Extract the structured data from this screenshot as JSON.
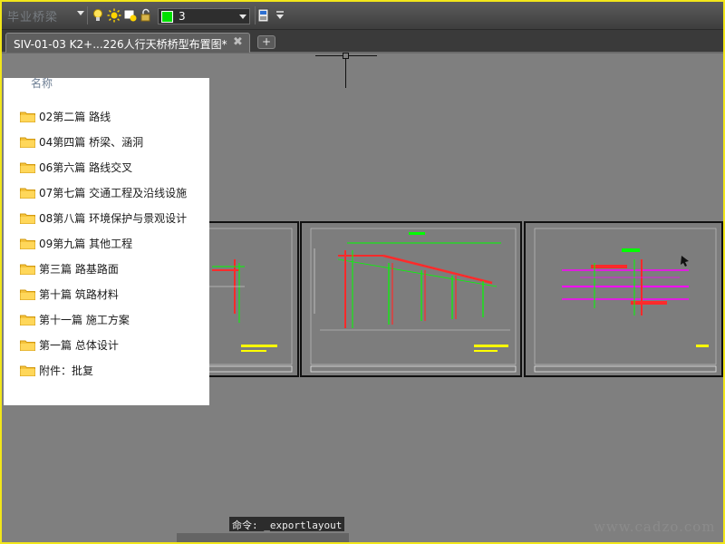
{
  "toolbar": {
    "ghost_text": "毕业桥梁",
    "layer": {
      "name": "3",
      "swatch_color": "#00e000"
    }
  },
  "tabs": [
    {
      "title": "SIV-01-03 K2+...226人行天桥桥型布置图*",
      "close": "✖"
    }
  ],
  "tab_add": "+",
  "folder_panel": {
    "header": "名称",
    "items": [
      "02第二篇 路线",
      "04第四篇 桥梁、涵洞",
      "06第六篇 路线交叉",
      "07第七篇 交通工程及沿线设施",
      "08第八篇 环境保护与景观设计",
      "09第九篇 其他工程",
      "第三篇 路基路面",
      "第十篇 筑路材料",
      "第十一篇 施工方案",
      "第一篇 总体设计",
      "附件：批复"
    ]
  },
  "command_line": "命令: _exportlayout",
  "watermark": "www.cadzo.com",
  "colors": {
    "accent_folder": "#f5c33b",
    "frame": "#f2e61a"
  }
}
